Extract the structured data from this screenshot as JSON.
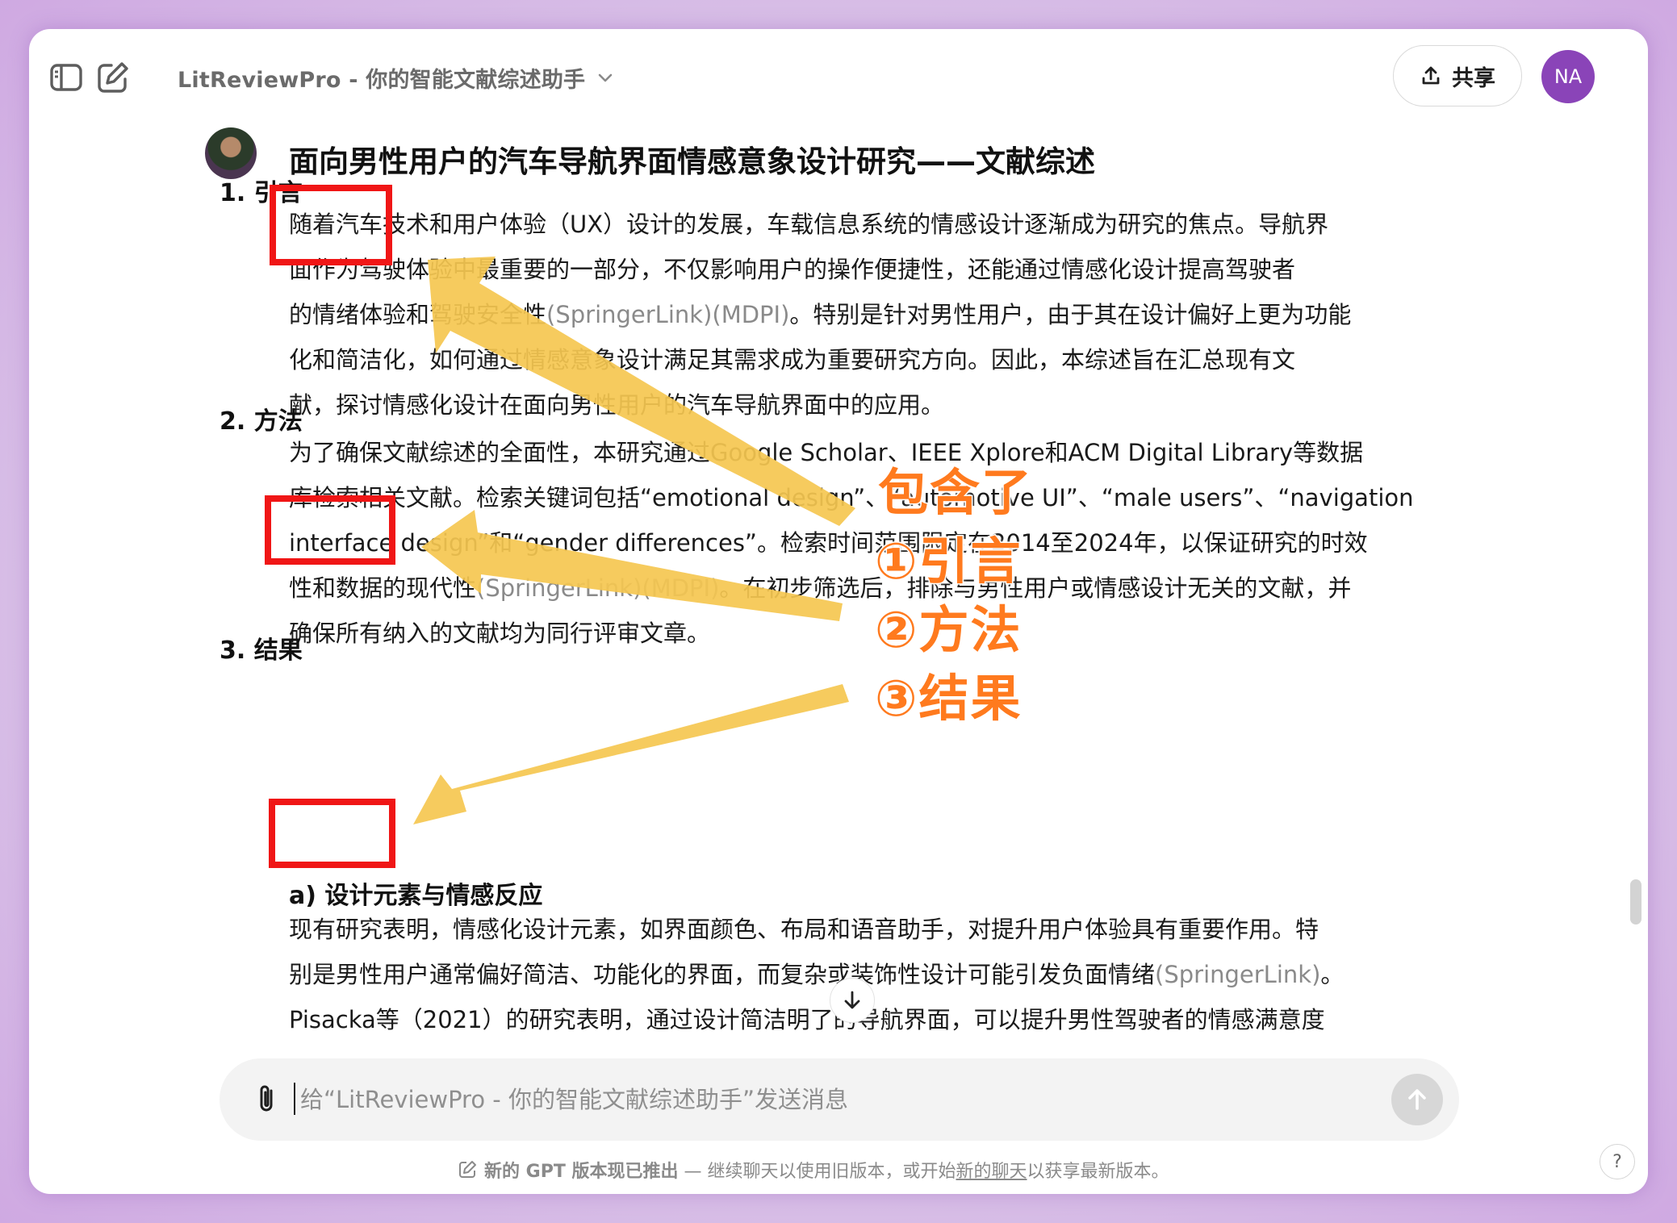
{
  "header": {
    "title": "LitReviewPro - 你的智能文献综述助手",
    "share_label": "共享",
    "avatar_initials": "NA"
  },
  "message": {
    "title": "面向男性用户的汽车导航界面情感意象设计研究——文献综述",
    "sections": [
      {
        "heading": "1. 引言",
        "lines": [
          {
            "text": "随着汽车技术和用户体验（UX）设计的发展，车载信息系统的情感设计逐渐成为研究的焦点。导航界"
          },
          {
            "text": "面作为驾驶体验中最重要的一部分，不仅影响用户的操作便捷性，还能通过情感化设计提高驾驶者"
          },
          {
            "text": "的情绪体验和驾驶安全性",
            "src": "(SpringerLink)(MDPI)",
            "after": "。特别是针对男性用户，由于其在设计偏好上更为功能"
          },
          {
            "text": "化和简洁化，如何通过情感意象设计满足其需求成为重要研究方向。因此，本综述旨在汇总现有文"
          },
          {
            "text": "献，探讨情感化设计在面向男性用户的汽车导航界面中的应用。"
          }
        ]
      },
      {
        "heading": "2. 方法",
        "lines": [
          {
            "text": "为了确保文献综述的全面性，本研究通过Google Scholar、IEEE Xplore和ACM Digital Library等数据"
          },
          {
            "text": "库检索相关文献。检索关键词包括“emotional design”、“automotive UI”、“male users”、“navigation"
          },
          {
            "text": "interface design”和“gender differences”。检索时间范围限定在2014至2024年，以保证研究的时效"
          },
          {
            "text": "性和数据的现代性",
            "src": "(SpringerLink)(MDPI)",
            "after": "。在初步筛选后，排除与男性用户或情感设计无关的文献，并"
          },
          {
            "text": "确保所有纳入的文献均为同行评审文章。"
          }
        ]
      },
      {
        "heading": "3. 结果",
        "subheading": "a) 设计元素与情感反应",
        "lines": [
          {
            "text": "现有研究表明，情感化设计元素，如界面颜色、布局和语音助手，对提升用户体验具有重要作用。特"
          },
          {
            "text": "别是男性用户通常偏好简洁、功能化的界面，而复杂或装饰性设计可能引发负面情绪",
            "src": "(SpringerLink)",
            "after": "。"
          },
          {
            "text": "Pisacka等（2021）的研究表明，通过设计简洁明了的导航界面，可以提升男性驾驶者的情感满意度"
          }
        ]
      }
    ]
  },
  "composer": {
    "placeholder": "给“LitReviewPro - 你的智能文献综述助手”发送消息"
  },
  "footer": {
    "bold": "新的 GPT 版本现已推出",
    "text1": " — 继续聊天以使用旧版本，或开始",
    "link": "新的聊天",
    "text2": "以获享最新版本。"
  },
  "help_label": "?",
  "annotation": {
    "lines": [
      "包含了",
      "①引言",
      "②方法",
      "③结果"
    ],
    "arrow_color": "#f5c750",
    "box_color": "#f01616",
    "text_color": "#ff7a1e"
  }
}
